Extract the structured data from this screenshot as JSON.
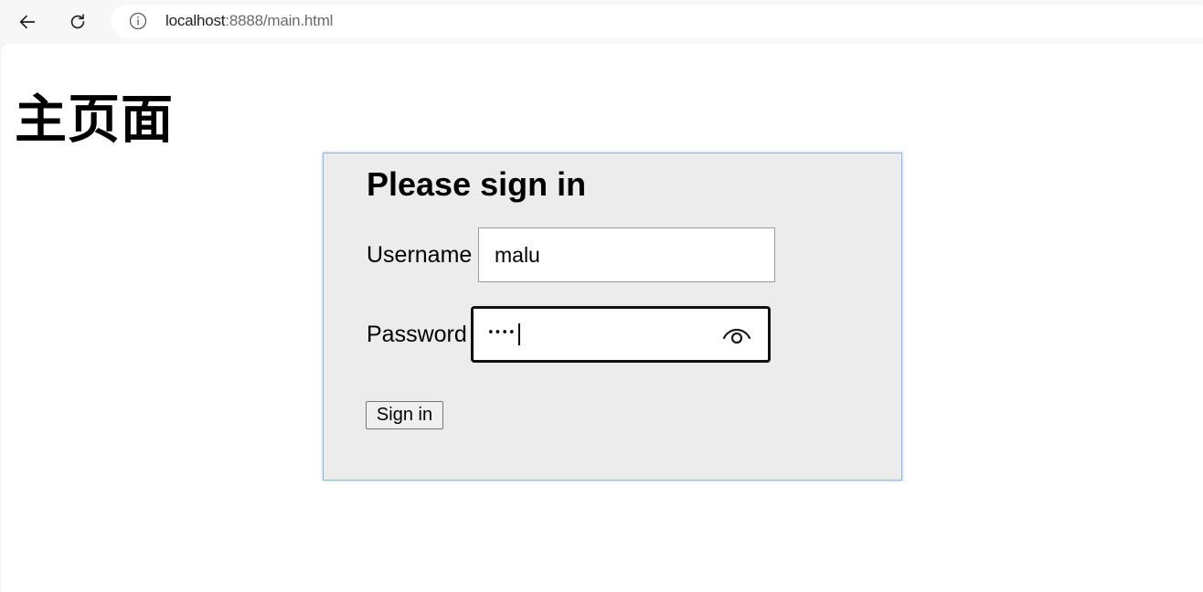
{
  "browser": {
    "url_host": "localhost",
    "url_rest": ":8888/main.html",
    "icons": {
      "back": "back-arrow-icon",
      "reload": "reload-icon",
      "site_info": "info-icon"
    }
  },
  "page": {
    "title": "主页面"
  },
  "login": {
    "heading": "Please sign in",
    "username_label": "Username",
    "username_value": "malu",
    "password_label": "Password",
    "password_mask": "••••",
    "reveal_icon": "eye-icon",
    "submit_label": "Sign in"
  },
  "colors": {
    "panel_background": "#ececec",
    "panel_border": "#8fb8f0",
    "focused_field_border": "#101010"
  }
}
